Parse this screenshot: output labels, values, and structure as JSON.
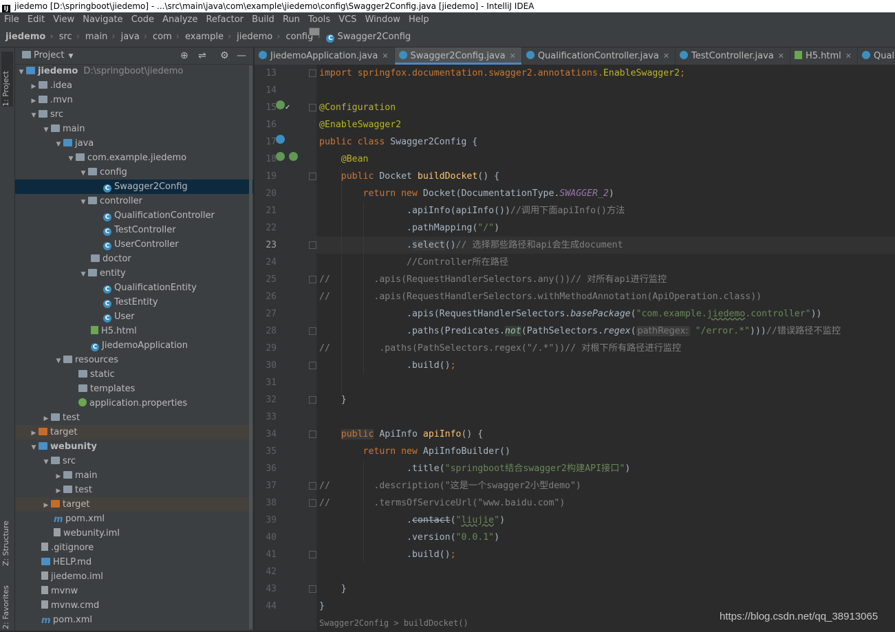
{
  "window": {
    "title": "jiedemo [D:\\springboot\\jiedemo] - ...\\src\\main\\java\\com\\example\\jiedemo\\config\\Swagger2Config.java [jiedemo] - IntelliJ IDEA"
  },
  "menu": [
    "File",
    "Edit",
    "View",
    "Navigate",
    "Code",
    "Analyze",
    "Refactor",
    "Build",
    "Run",
    "Tools",
    "VCS",
    "Window",
    "Help"
  ],
  "breadcrumb": [
    "jiedemo",
    "src",
    "main",
    "java",
    "com",
    "example",
    "jiedemo",
    "config",
    "Swagger2Config"
  ],
  "side_tabs": {
    "project": "1: Project",
    "structure": "Z: Structure",
    "favorites": "2: Favorites"
  },
  "project_panel": {
    "title": "Project"
  },
  "tree": [
    {
      "label": "jiedemo",
      "path": "D:\\springboot\\jiedemo"
    },
    {
      "label": ".idea"
    },
    {
      "label": ".mvn"
    },
    {
      "label": "src"
    },
    {
      "label": "main"
    },
    {
      "label": "java"
    },
    {
      "label": "com.example.jiedemo"
    },
    {
      "label": "config"
    },
    {
      "label": "Swagger2Config"
    },
    {
      "label": "controller"
    },
    {
      "label": "QualificationController"
    },
    {
      "label": "TestController"
    },
    {
      "label": "UserController"
    },
    {
      "label": "doctor"
    },
    {
      "label": "entity"
    },
    {
      "label": "QualificationEntity"
    },
    {
      "label": "TestEntity"
    },
    {
      "label": "User"
    },
    {
      "label": "H5.html"
    },
    {
      "label": "JiedemoApplication"
    },
    {
      "label": "resources"
    },
    {
      "label": "static"
    },
    {
      "label": "templates"
    },
    {
      "label": "application.properties"
    },
    {
      "label": "test"
    },
    {
      "label": "target"
    },
    {
      "label": "webunity"
    },
    {
      "label": "src"
    },
    {
      "label": "main"
    },
    {
      "label": "test"
    },
    {
      "label": "target"
    },
    {
      "label": "pom.xml"
    },
    {
      "label": "webunity.iml"
    },
    {
      "label": ".gitignore"
    },
    {
      "label": "HELP.md"
    },
    {
      "label": "jiedemo.iml"
    },
    {
      "label": "mvnw"
    },
    {
      "label": "mvnw.cmd"
    },
    {
      "label": "pom.xml"
    }
  ],
  "tabs": [
    "JiedemoApplication.java",
    "Swagger2Config.java",
    "QualificationController.java",
    "TestController.java",
    "H5.html",
    "QualificationEn"
  ],
  "line_numbers": [
    "13",
    "14",
    "15",
    "16",
    "17",
    "18",
    "19",
    "20",
    "21",
    "22",
    "23",
    "24",
    "25",
    "26",
    "27",
    "28",
    "29",
    "30",
    "31",
    "32",
    "33",
    "34",
    "35",
    "36",
    "37",
    "38",
    "39",
    "40",
    "41",
    "42",
    "43",
    "44"
  ],
  "code": {
    "l13": [
      "import springfox.documentation.swagger2.annotations.",
      "EnableSwagger2",
      ";"
    ],
    "l15": "@Configuration",
    "l16": "@EnableSwagger2",
    "l17": [
      "public class ",
      "Swagger2Config {"
    ],
    "l18": "@Bean",
    "l19": [
      "public ",
      "Docket ",
      "buildDocket",
      "() {"
    ],
    "l20": [
      "return new ",
      "Docket(DocumentationType.",
      "SWAGGER_2",
      ")"
    ],
    "l21": [
      ".apiInfo(apiInfo())",
      "//调用下面apiInfo()方法"
    ],
    "l22": [
      ".pathMapping(",
      "\"/\"",
      ")"
    ],
    "l23": [
      ".",
      "select",
      "()",
      "// 选择那些路径和api会生成document"
    ],
    "l24": "//Controller所在路径",
    "l25": [
      "//",
      "        .apis(RequestHandlerSelectors.any())// 对所有api进行监控"
    ],
    "l26": [
      "//",
      "        .apis(RequestHandlerSelectors.withMethodAnnotation(ApiOperation.class))"
    ],
    "l27": [
      ".apis(RequestHandlerSelectors.",
      "basePackage",
      "(",
      "\"com.example.",
      "jiedemo",
      ".controller\"",
      "))"
    ],
    "l28": [
      ".paths(Predicates.",
      "not",
      "(PathSelectors.",
      "regex",
      "(",
      "pathRegex:",
      "\"/error.*\"",
      ")))",
      "//错误路径不监控"
    ],
    "l29": [
      "//",
      "         .paths(PathSelectors.regex(\"/.*\"))// 对根下所有路径进行监控"
    ],
    "l30": [
      ".build()",
      ";"
    ],
    "l32": "}",
    "l34": [
      "public",
      " ApiInfo ",
      "apiInfo",
      "() {"
    ],
    "l35": [
      "return new ",
      "ApiInfoBuilder()"
    ],
    "l36": [
      ".title(",
      "\"springboot结合swagger2构建API接口\"",
      ")"
    ],
    "l37": [
      "//",
      "        .description(\"这是一个swagger2小型demo\")"
    ],
    "l38": [
      "//",
      "        .termsOfServiceUrl(\"www.baidu.com\")"
    ],
    "l39": [
      ".",
      "contact",
      "(",
      "\"",
      "liujie",
      "\"",
      ")"
    ],
    "l40": [
      ".version(",
      "\"0.0.1\"",
      ")"
    ],
    "l41": [
      ".build()",
      ";"
    ],
    "l43": "}",
    "l44": "}"
  },
  "status_fragment": "Swagger2Config > buildDocket()",
  "watermark": "https://blog.csdn.net/qq_38913065",
  "colors": {
    "keyword": "#cc7832",
    "annotation": "#bbb529",
    "method": "#ffc66d",
    "string": "#6a8759",
    "comment": "#808080",
    "static": "#9876aa",
    "text": "#a9b7c6",
    "selection": "#0d293e"
  }
}
